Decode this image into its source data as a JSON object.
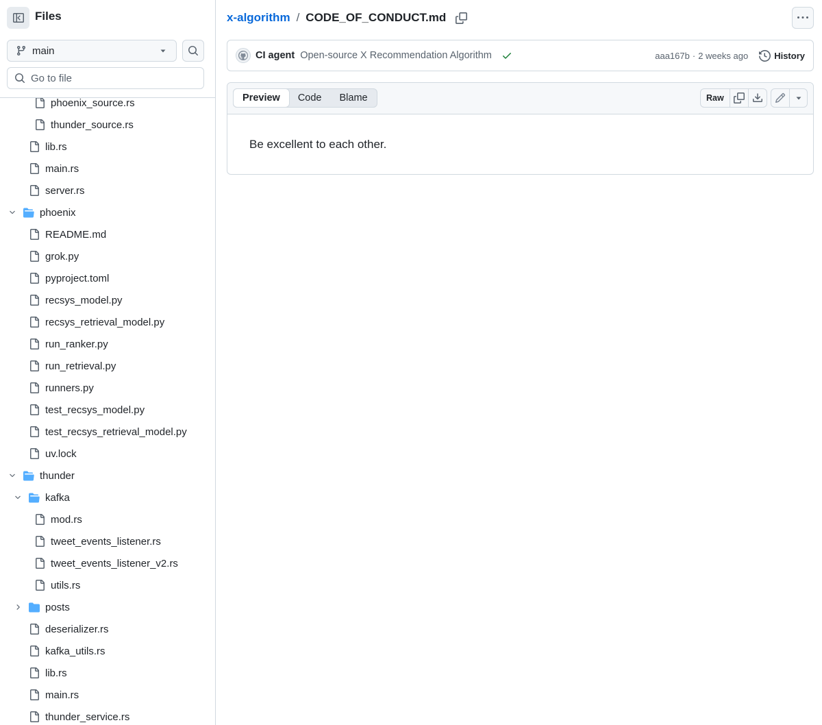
{
  "sidebar": {
    "title": "Files",
    "branch": "main",
    "goto_placeholder": "Go to file",
    "tree": [
      {
        "name": "phoenix_source.rs",
        "type": "file",
        "depth": 3
      },
      {
        "name": "thunder_source.rs",
        "type": "file",
        "depth": 3
      },
      {
        "name": "lib.rs",
        "type": "file",
        "depth": 2
      },
      {
        "name": "main.rs",
        "type": "file",
        "depth": 2
      },
      {
        "name": "server.rs",
        "type": "file",
        "depth": 2
      },
      {
        "name": "phoenix",
        "type": "folder",
        "expanded": true,
        "depth": 1
      },
      {
        "name": "README.md",
        "type": "file",
        "depth": 2
      },
      {
        "name": "grok.py",
        "type": "file",
        "depth": 2
      },
      {
        "name": "pyproject.toml",
        "type": "file",
        "depth": 2
      },
      {
        "name": "recsys_model.py",
        "type": "file",
        "depth": 2
      },
      {
        "name": "recsys_retrieval_model.py",
        "type": "file",
        "depth": 2
      },
      {
        "name": "run_ranker.py",
        "type": "file",
        "depth": 2
      },
      {
        "name": "run_retrieval.py",
        "type": "file",
        "depth": 2
      },
      {
        "name": "runners.py",
        "type": "file",
        "depth": 2
      },
      {
        "name": "test_recsys_model.py",
        "type": "file",
        "depth": 2
      },
      {
        "name": "test_recsys_retrieval_model.py",
        "type": "file",
        "depth": 2
      },
      {
        "name": "uv.lock",
        "type": "file",
        "depth": 2
      },
      {
        "name": "thunder",
        "type": "folder",
        "expanded": true,
        "depth": 1
      },
      {
        "name": "kafka",
        "type": "folder",
        "expanded": true,
        "depth": 2
      },
      {
        "name": "mod.rs",
        "type": "file",
        "depth": 3
      },
      {
        "name": "tweet_events_listener.rs",
        "type": "file",
        "depth": 3
      },
      {
        "name": "tweet_events_listener_v2.rs",
        "type": "file",
        "depth": 3
      },
      {
        "name": "utils.rs",
        "type": "file",
        "depth": 3
      },
      {
        "name": "posts",
        "type": "folder",
        "expanded": false,
        "depth": 2
      },
      {
        "name": "deserializer.rs",
        "type": "file",
        "depth": 2
      },
      {
        "name": "kafka_utils.rs",
        "type": "file",
        "depth": 2
      },
      {
        "name": "lib.rs",
        "type": "file",
        "depth": 2
      },
      {
        "name": "main.rs",
        "type": "file",
        "depth": 2
      },
      {
        "name": "thunder_service.rs",
        "type": "file",
        "depth": 2
      }
    ]
  },
  "header": {
    "repo": "x-algorithm",
    "separator": "/",
    "file": "CODE_OF_CONDUCT.md"
  },
  "commit": {
    "author": "CI agent",
    "message": "Open-source X Recommendation Algorithm",
    "sha": "aaa167b",
    "dot": "·",
    "time_ago": "2 weeks ago",
    "history_label": "History"
  },
  "file_view": {
    "tabs": [
      "Preview",
      "Code",
      "Blame"
    ],
    "active_tab": "Preview",
    "raw_label": "Raw",
    "content": "Be excellent to each other."
  },
  "colors": {
    "accent": "#0969da",
    "folder": "#54aeff",
    "success": "#1a7f37",
    "border": "#d1d9e0",
    "muted": "#59636e"
  },
  "icons": [
    "sidebar-collapse-icon",
    "git-branch-icon",
    "triangle-down-icon",
    "search-icon",
    "copy-icon",
    "kebab-horizontal-icon",
    "check-icon",
    "history-icon",
    "download-icon",
    "pencil-icon",
    "file-icon",
    "folder-open-icon",
    "folder-icon",
    "chevron-down-icon",
    "chevron-right-icon"
  ]
}
